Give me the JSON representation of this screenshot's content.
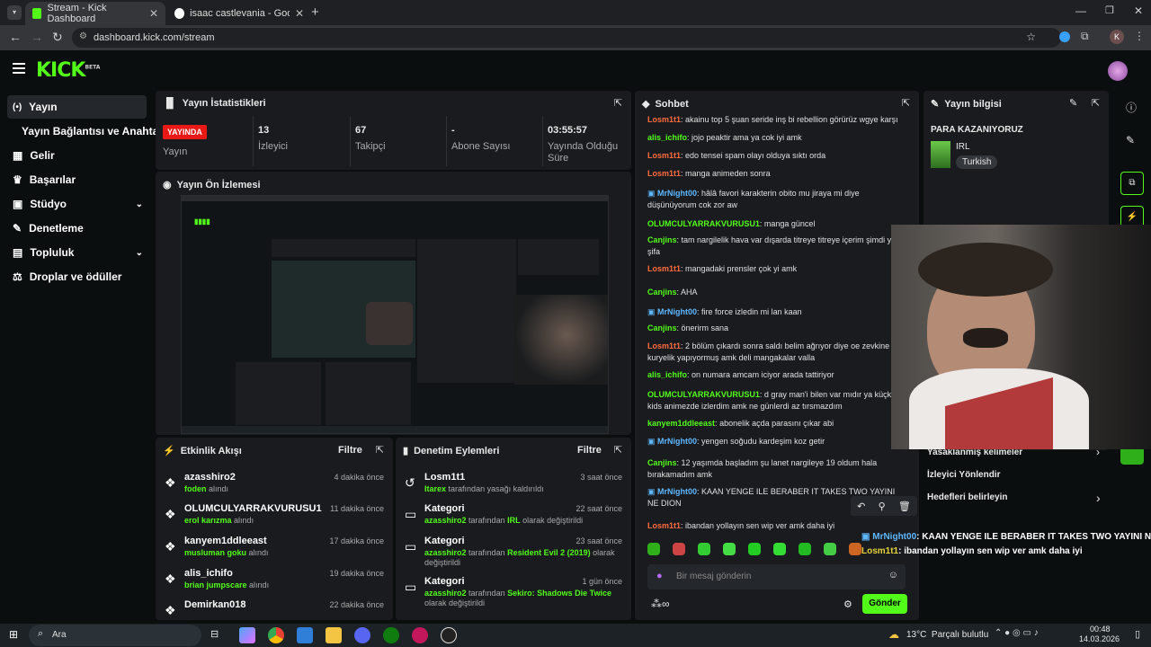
{
  "browser": {
    "tabs": [
      {
        "title": "Stream - Kick Dashboard"
      },
      {
        "title": "isaac castlevania - Google'da A"
      }
    ],
    "url": "dashboard.kick.com/stream",
    "profile_initial": "K"
  },
  "brand": {
    "logo": "KICK",
    "beta": "BETA"
  },
  "sidebar": {
    "items": [
      {
        "label": "Yayın",
        "icon": "broadcast-icon"
      },
      {
        "label": "Yayın Bağlantısı ve Anahtarı",
        "icon": ""
      },
      {
        "label": "Gelir",
        "icon": "revenue-icon"
      },
      {
        "label": "Başarılar",
        "icon": "trophy-icon"
      },
      {
        "label": "Stüdyo",
        "icon": "studio-icon"
      },
      {
        "label": "Denetleme",
        "icon": "moderation-icon"
      },
      {
        "label": "Topluluk",
        "icon": "community-icon"
      },
      {
        "label": "Droplar ve ödüller",
        "icon": "drops-icon"
      }
    ]
  },
  "stats": {
    "title": "Yayın İstatistikleri",
    "live_badge": "YAYINDA",
    "live_label": "Yayın",
    "viewers": "13",
    "viewers_label": "İzleyici",
    "followers": "67",
    "followers_label": "Takipçi",
    "subs": "-",
    "subs_label": "Abone Sayısı",
    "uptime": "03:55:57",
    "uptime_label": "Yayında Olduğu Süre"
  },
  "preview": {
    "title": "Yayın Ön İzlemesi"
  },
  "activity": {
    "title": "Etkinlik Akışı",
    "filter": "Filtre",
    "suffix": "alındı",
    "items": [
      {
        "name": "azasshiro2",
        "item": "foden",
        "time": "4 dakika önce"
      },
      {
        "name": "OLUMCULYARRAKVURUSU1",
        "item": "erol karızma",
        "time": "11 dakika önce"
      },
      {
        "name": "kanyem1ddleeast",
        "item": "musluman goku",
        "time": "17 dakika önce"
      },
      {
        "name": "alis_ichifo",
        "item": "brian jumpscare",
        "time": "19 dakika önce"
      },
      {
        "name": "Demirkan018",
        "item": "",
        "time": "22 dakika önce"
      }
    ]
  },
  "modlog": {
    "title": "Denetim Eylemleri",
    "filter": "Filtre",
    "items": [
      {
        "title": "Losm1t1",
        "by": "Itarex",
        "text": "tarafından yasağı kaldırıldı",
        "value": "",
        "tail": "",
        "time": "3 saat önce"
      },
      {
        "title": "Kategori",
        "by": "azasshiro2",
        "text": "tarafından",
        "value": "IRL",
        "tail": "olarak değiştirildi",
        "time": "22 saat önce"
      },
      {
        "title": "Kategori",
        "by": "azasshiro2",
        "text": "tarafından",
        "value": "Resident Evil 2 (2019)",
        "tail": "olarak değiştirildi",
        "time": "23 saat önce"
      },
      {
        "title": "Kategori",
        "by": "azasshiro2",
        "text": "tarafından",
        "value": "Sekiro: Shadows Die Twice",
        "tail": "olarak değiştirildi",
        "time": "1 gün önce"
      }
    ]
  },
  "chat": {
    "title": "Sohbet",
    "placeholder": "Bir mesaj gönderin",
    "send": "Gönder",
    "messages": [
      {
        "user": "Losm1t1",
        "color": "#ff6b3d",
        "text": "akainu top 5 şuan seride inş bi rebellion görürüz wgye karşı"
      },
      {
        "user": "alis_ichifo",
        "color": "#53fc18",
        "text": "jojo peaktir ama ya cok iyi amk"
      },
      {
        "user": "Losm1t1",
        "color": "#ff6b3d",
        "text": "edo tensei spam olayı olduya sıktı orda"
      },
      {
        "user": "Losm1t1",
        "color": "#ff6b3d",
        "text": "manga animeden sonra"
      },
      {
        "user": "MrNight00",
        "color": "#5fb8ff",
        "text": "hâlâ favori karakterin obito mu jiraya mi diye düşünüyorum cok zor aw"
      },
      {
        "user": "OLUMCULYARRAKVURUSU1",
        "color": "#53fc18",
        "text": "manga güncel"
      },
      {
        "user": "Canjins",
        "color": "#53fc18",
        "text": "tam nargilelik hava var dışarda titreye titreye içerim şimdi ya şifa"
      },
      {
        "user": "Losm1t1",
        "color": "#ff6b3d",
        "text": "mangadaki prensler çok yi amk"
      },
      {
        "user": "Canjins",
        "color": "#53fc18",
        "text": "AHA"
      },
      {
        "user": "MrNight00",
        "color": "#5fb8ff",
        "text": "fire force izledin mi lan kaan"
      },
      {
        "user": "Canjins",
        "color": "#53fc18",
        "text": "önerirm sana"
      },
      {
        "user": "Losm1t1",
        "color": "#ff6b3d",
        "text": "2 bölüm çıkardı sonra saldı belim ağrıyor diye oe zevkine kuryelik yapıyormuş amk deli mangakalar valla"
      },
      {
        "user": "alis_ichifo",
        "color": "#53fc18",
        "text": "on numara amcam iciyor arada tattiriyor"
      },
      {
        "user": "OLUMCULYARRAKVURUSU1",
        "color": "#53fc18",
        "text": "d gray man'i bilen var mıdır ya küçkken kids animezde izlerdim amk ne günlerdi az tırsmazdım"
      },
      {
        "user": "kanyem1ddleeast",
        "color": "#53fc18",
        "text": "abonelik açda parasını çıkar abi"
      },
      {
        "user": "MrNight00",
        "color": "#5fb8ff",
        "text": "yengen soğudu kardeşim koz getir"
      },
      {
        "user": "Canjins",
        "color": "#53fc18",
        "text": "12 yaşımda başladım şu lanet nargileye 19 oldum hala bırakamadım amk"
      },
      {
        "user": "MrNight00",
        "color": "#5fb8ff",
        "text": "KAAN YENGE ILE BERABER IT TAKES TWO YAYINI NE DION"
      },
      {
        "user": "Losm1t1",
        "color": "#ff6b3d",
        "text": "ibandan yollayın sen wip ver amk daha iyi"
      }
    ]
  },
  "info": {
    "title": "Yayın bilgisi",
    "stream_title": "PARA KAZANIYORUZ",
    "category": "IRL",
    "tag": "Turkish",
    "actions": [
      "Yasaklanmış kelimeler",
      "İzleyici Yönlendir",
      "Hedefleri belirleyin"
    ]
  },
  "overlay": {
    "line1_user": "MrNight00",
    "line1_text": ": KAAN YENGE ILE BERABER IT TAKES TWO YAYINI NE",
    "line2_user": "Losm1t1",
    "line2_text": ": ibandan yollayın sen wip ver amk daha iyi"
  },
  "taskbar": {
    "search": "Ara",
    "weather": "13°C  Parçalı bulutlu",
    "time": "00:48",
    "date": "14.03.2026"
  },
  "colors": {
    "accent": "#53fc18",
    "live": "#e91916",
    "panel": "#191b1f",
    "bg": "#0b0e0f"
  }
}
